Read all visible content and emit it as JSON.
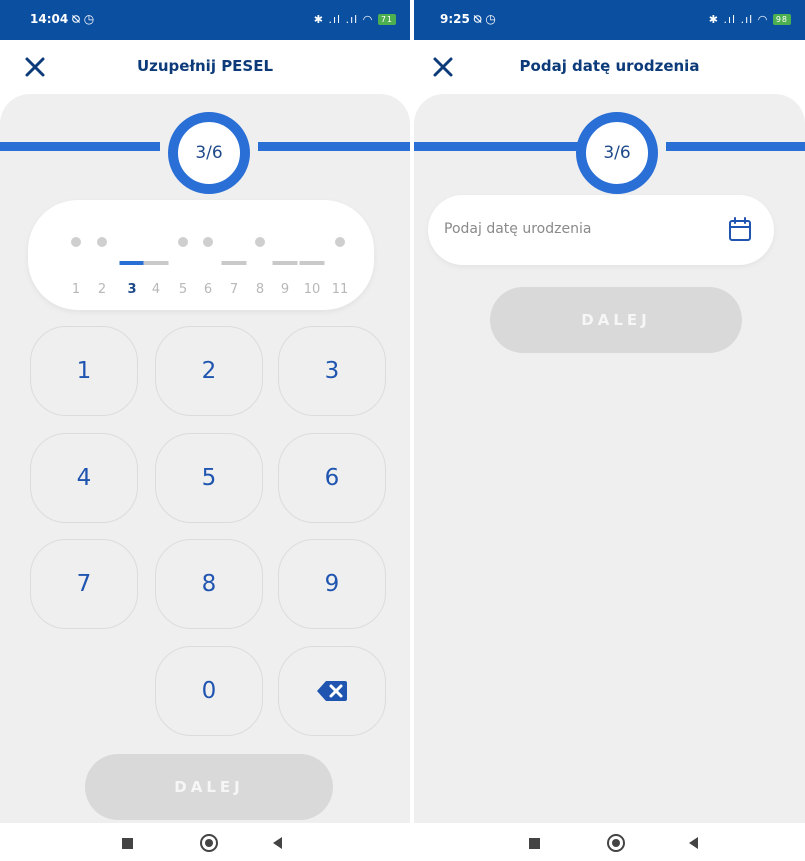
{
  "left_screen": {
    "status_bar": {
      "time": "14:04",
      "left_icons": "⍉ ◷",
      "right_icons": "✱ .ıl .ıl ◠",
      "battery": "71"
    },
    "header": {
      "title": "Uzupełnij PESEL",
      "close_icon": "close-icon"
    },
    "progress": {
      "label": "3/6"
    },
    "pesel": {
      "active_slot": 3,
      "slots": [
        {
          "num": "1",
          "state": "dot"
        },
        {
          "num": "2",
          "state": "dot"
        },
        {
          "num": "3",
          "state": "active"
        },
        {
          "num": "4",
          "state": "empty"
        },
        {
          "num": "5",
          "state": "dot"
        },
        {
          "num": "6",
          "state": "dot"
        },
        {
          "num": "7",
          "state": "empty"
        },
        {
          "num": "8",
          "state": "dot"
        },
        {
          "num": "9",
          "state": "empty"
        },
        {
          "num": "10",
          "state": "empty"
        },
        {
          "num": "11",
          "state": "dot"
        }
      ]
    },
    "keypad": {
      "keys": [
        "1",
        "2",
        "3",
        "4",
        "5",
        "6",
        "7",
        "8",
        "9",
        "0"
      ],
      "backspace_icon": "backspace-icon"
    },
    "dalej_label": "DALEJ"
  },
  "right_screen": {
    "status_bar": {
      "time": "9:25",
      "left_icons": "⍉ ◷",
      "right_icons": "✱ .ıl .ıl ◠",
      "battery": "98"
    },
    "header": {
      "title": "Podaj datę urodzenia",
      "close_icon": "close-icon"
    },
    "progress": {
      "label": "3/6"
    },
    "date_input": {
      "placeholder": "Podaj datę urodzenia",
      "icon": "calendar-icon"
    },
    "dalej_label": "DALEJ"
  },
  "nav_bar": {
    "icons": [
      "recent-apps-icon",
      "home-icon",
      "back-icon"
    ]
  },
  "colors": {
    "status_bar": "#0b4fa0",
    "accent": "#2a6fd6",
    "title": "#0d3b7a",
    "button_disabled": "#d9d9d9"
  }
}
